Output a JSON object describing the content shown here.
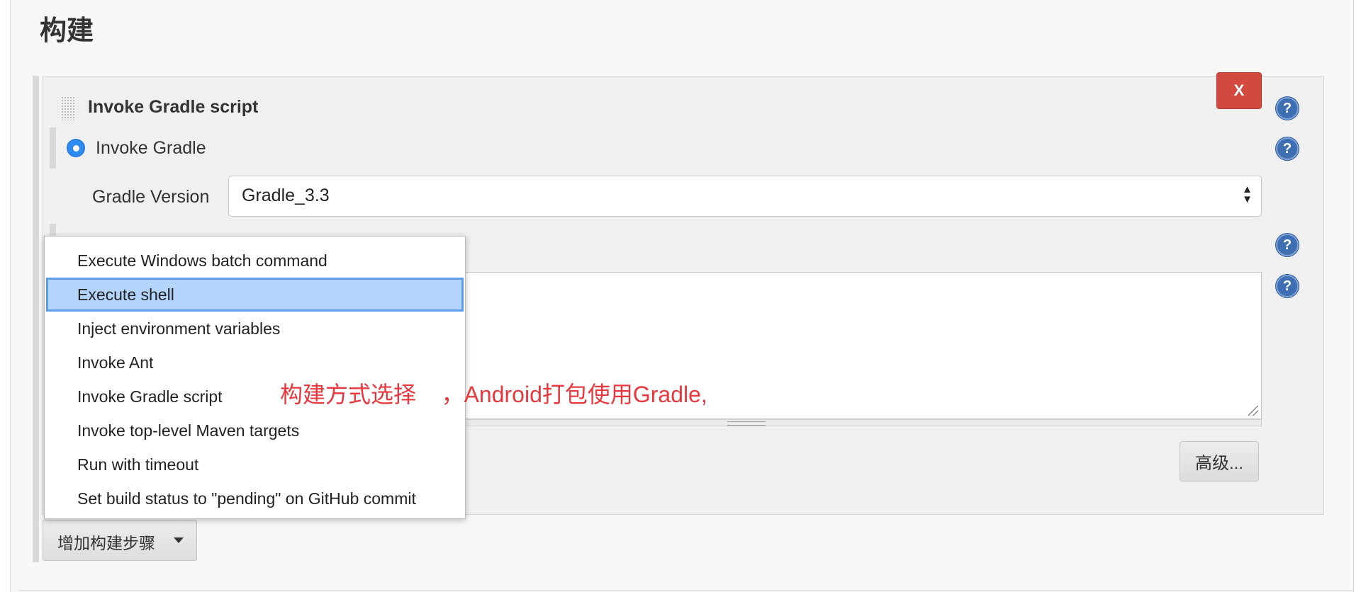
{
  "section": {
    "title": "构建"
  },
  "step": {
    "title": "Invoke Gradle script",
    "delete_label": "X",
    "help_glyph": "?",
    "radio_label": "Invoke Gradle",
    "gradle_version_label": "Gradle Version",
    "gradle_version_value": "Gradle_3.3",
    "advanced_label": "高级..."
  },
  "add_step": {
    "label": "增加构建步骤"
  },
  "menu": {
    "items": [
      "Execute Windows batch command",
      "Execute shell",
      "Inject environment variables",
      "Invoke Ant",
      "Invoke Gradle script",
      "Invoke top-level Maven targets",
      "Run with timeout",
      "Set build status to \"pending\" on GitHub commit"
    ],
    "selected_index": 1
  },
  "annotation": {
    "text": "构建方式选择    ，Android打包使用Gradle,"
  },
  "colors": {
    "accent": "#2d8cf0",
    "delete": "#d24a3f",
    "help": "#3f6fb3",
    "selection": "#b3d4fc",
    "annotation": "#e8383d"
  }
}
